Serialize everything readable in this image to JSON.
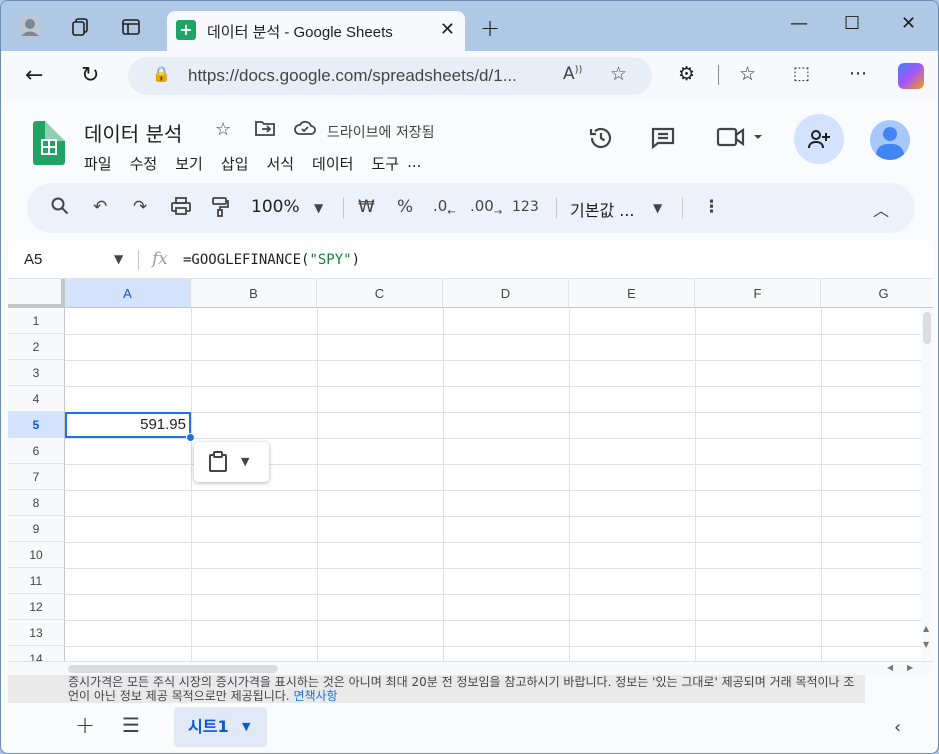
{
  "browser": {
    "tab_title": "데이터 분석 - Google Sheets",
    "url": "https://docs.google.com/spreadsheets/d/1..."
  },
  "doc": {
    "title": "데이터 분석",
    "save_status": "드라이브에 저장됨",
    "menus": [
      "파일",
      "수정",
      "보기",
      "삽입",
      "서식",
      "데이터",
      "도구",
      "..."
    ]
  },
  "toolbar": {
    "zoom": "100%",
    "currency": "₩",
    "percent": "%",
    "dec_decrease": ".0",
    "dec_increase": ".00",
    "number_format": "123",
    "font": "기본값 ..."
  },
  "formula_bar": {
    "name_box": "A5",
    "formula_prefix": "=GOOGLEFINANCE(",
    "formula_string": "\"SPY\"",
    "formula_suffix": ")"
  },
  "grid": {
    "columns": [
      "A",
      "B",
      "C",
      "D",
      "E",
      "F",
      "G"
    ],
    "rows": [
      "1",
      "2",
      "3",
      "4",
      "5",
      "6",
      "7",
      "8",
      "9",
      "10",
      "11",
      "12",
      "13",
      "14"
    ],
    "selected_column": "A",
    "selected_row": "5",
    "cell_a5_value": "591.95"
  },
  "disclaimer": {
    "text": "증시가격은 모든 주식 시장의 증시가격을 표시하는 것은 아니며 최대 20분 전 정보임을 참고하시기 바랍니다. 정보는 '있는 그대로' 제공되며 거래 목적이나 조언이 아닌 정보 제공 목적으로만 제공됩니다.",
    "link": "면책사항"
  },
  "sheets": {
    "active_sheet": "시트1"
  },
  "colors": {
    "accent": "#1a73e8",
    "sheets_green": "#1fa463",
    "formula_string": "#188038",
    "selected_header": "#d3e3fd"
  }
}
